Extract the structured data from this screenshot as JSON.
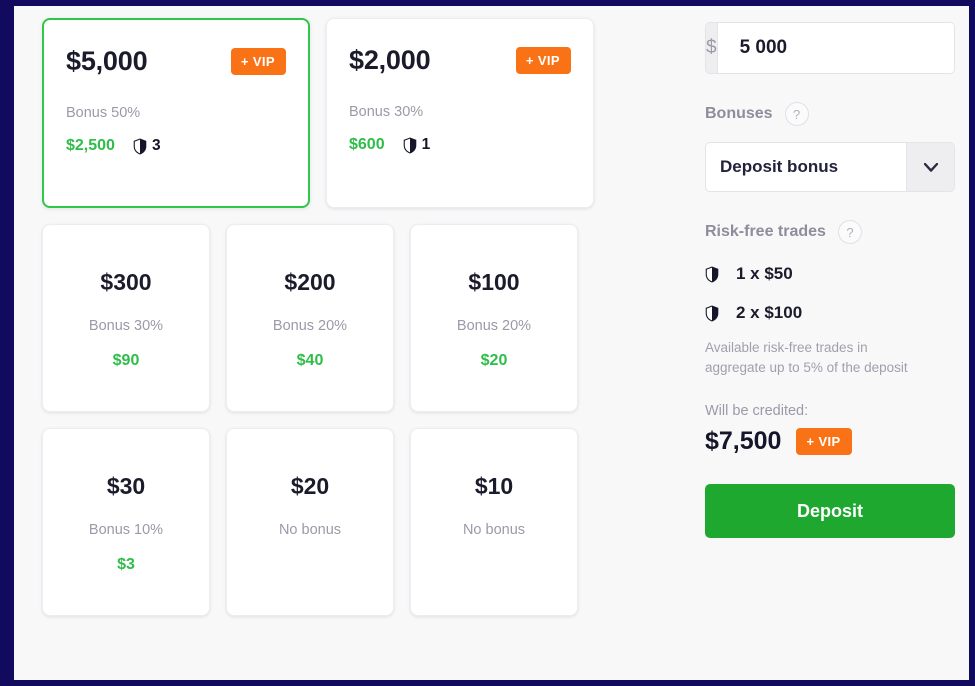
{
  "theme": {
    "frame_color": "#110a5e",
    "surface_bg": "#f8f8f9",
    "accent_green": "#2fbd4a",
    "selected_border": "#2fc748",
    "vip_orange": "#f97316",
    "deposit_green": "#1fa830",
    "muted_text": "#9a9aa8",
    "dark_text": "#1b1b2b"
  },
  "amount_cards": {
    "row_top": [
      {
        "amount": "$5,000",
        "bonus_label": "Bonus 50%",
        "bonus_amount": "$2,500",
        "vip_badge": "+ VIP",
        "has_vip": true,
        "shield_count": "3",
        "has_shield": true,
        "selected": true
      },
      {
        "amount": "$2,000",
        "bonus_label": "Bonus 30%",
        "bonus_amount": "$600",
        "vip_badge": "+ VIP",
        "has_vip": true,
        "shield_count": "1",
        "has_shield": true,
        "selected": false
      }
    ],
    "row_middle": [
      {
        "amount": "$300",
        "bonus_label": "Bonus 30%",
        "bonus_amount": "$90",
        "has_vip": false,
        "has_shield": false,
        "selected": false
      },
      {
        "amount": "$200",
        "bonus_label": "Bonus 20%",
        "bonus_amount": "$40",
        "has_vip": false,
        "has_shield": false,
        "selected": false
      },
      {
        "amount": "$100",
        "bonus_label": "Bonus 20%",
        "bonus_amount": "$20",
        "has_vip": false,
        "has_shield": false,
        "selected": false
      }
    ],
    "row_bottom": [
      {
        "amount": "$30",
        "bonus_label": "Bonus 10%",
        "bonus_amount": "$3",
        "has_vip": false,
        "has_shield": false,
        "selected": false
      },
      {
        "amount": "$20",
        "bonus_label": "No bonus",
        "bonus_amount": "",
        "has_vip": false,
        "has_shield": false,
        "selected": false
      },
      {
        "amount": "$10",
        "bonus_label": "No bonus",
        "bonus_amount": "",
        "has_vip": false,
        "has_shield": false,
        "selected": false
      }
    ]
  },
  "deposit_panel": {
    "amount_field": {
      "currency_symbol": "$",
      "value": "5 000",
      "placeholder": "0"
    },
    "bonuses": {
      "label": "Bonuses",
      "help": "?",
      "selected_option": "Deposit bonus",
      "options": [
        "Deposit bonus"
      ]
    },
    "risk_free": {
      "label": "Risk-free trades",
      "help": "?",
      "items": [
        {
          "icon": "shield-icon",
          "text": "1 x $50"
        },
        {
          "icon": "shield-icon",
          "text": "2 x $100"
        }
      ],
      "note": "Available risk-free trades in aggregate up to 5% of the deposit"
    },
    "credited": {
      "label": "Will be credited:",
      "amount": "$7,500",
      "vip_badge": "+ VIP"
    },
    "deposit_button": "Deposit"
  }
}
